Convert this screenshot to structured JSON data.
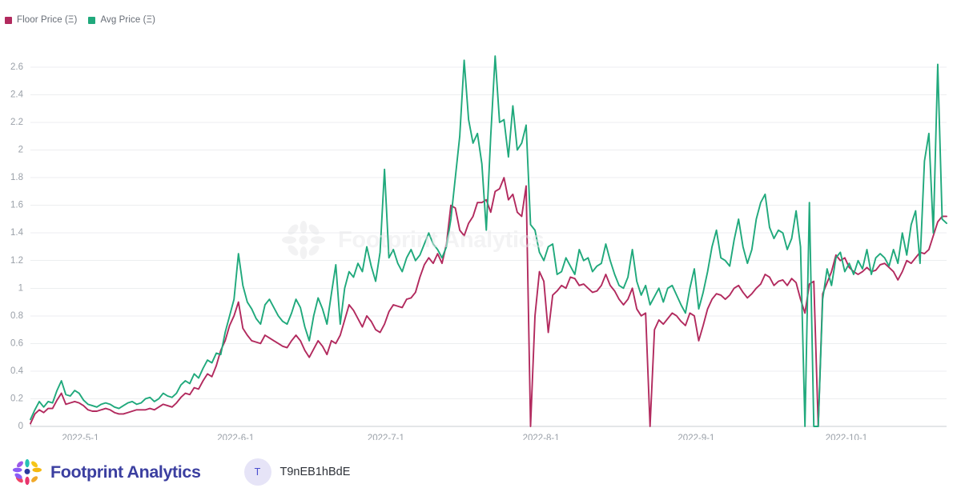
{
  "legend": {
    "items": [
      {
        "label": "Floor Price (Ξ)",
        "color": "#b22a5e",
        "name": "floor-price"
      },
      {
        "label": "Avg Price (Ξ)",
        "color": "#20a97c",
        "name": "avg-price"
      }
    ]
  },
  "watermark": {
    "text": "Footprint Analytics"
  },
  "footer": {
    "brand_name": "Footprint Analytics",
    "avatar_initial": "T",
    "collection_name": "T9nEB1hBdE"
  },
  "chart_data": {
    "type": "line",
    "title": "",
    "xlabel": "",
    "ylabel": "",
    "ylim": [
      0,
      2.75
    ],
    "yticks": [
      0,
      0.2,
      0.4,
      0.6,
      0.8,
      1,
      1.2,
      1.4,
      1.6,
      1.8,
      2,
      2.2,
      2.4,
      2.6
    ],
    "ytick_labels": [
      "0",
      "0.2",
      "0.4",
      "0.6",
      "0.8",
      "1",
      "1.2",
      "1.4",
      "1.6",
      "1.8",
      "2",
      "2.2",
      "2.4",
      "2.6"
    ],
    "xtick_labels": [
      "2022-5-1",
      "2022-6-1",
      "2022-7-1",
      "2022-8-1",
      "2022-9-1",
      "2022-10-1"
    ],
    "xtick_days": [
      10,
      41,
      71,
      102,
      133,
      163
    ],
    "x_domain_days": [
      0,
      183
    ],
    "grid": true,
    "legend_position": "top-left",
    "colors": {
      "floor_price": "#b22a5e",
      "avg_price": "#20a97c",
      "grid": "#eceef0",
      "axis": "#c9ccd1"
    },
    "series": [
      {
        "name": "Floor Price (Ξ)",
        "color": "#b22a5e",
        "values": [
          0.02,
          0.09,
          0.12,
          0.1,
          0.13,
          0.13,
          0.19,
          0.24,
          0.16,
          0.17,
          0.18,
          0.17,
          0.15,
          0.12,
          0.11,
          0.11,
          0.12,
          0.13,
          0.12,
          0.1,
          0.09,
          0.09,
          0.1,
          0.11,
          0.12,
          0.12,
          0.12,
          0.13,
          0.12,
          0.14,
          0.16,
          0.15,
          0.14,
          0.17,
          0.21,
          0.24,
          0.23,
          0.28,
          0.27,
          0.33,
          0.38,
          0.36,
          0.44,
          0.55,
          0.62,
          0.73,
          0.8,
          0.9,
          0.71,
          0.66,
          0.62,
          0.61,
          0.6,
          0.66,
          0.64,
          0.62,
          0.6,
          0.58,
          0.57,
          0.62,
          0.66,
          0.62,
          0.55,
          0.5,
          0.56,
          0.62,
          0.58,
          0.52,
          0.62,
          0.6,
          0.66,
          0.77,
          0.88,
          0.84,
          0.78,
          0.72,
          0.8,
          0.76,
          0.7,
          0.68,
          0.74,
          0.83,
          0.88,
          0.87,
          0.86,
          0.92,
          0.93,
          0.97,
          1.08,
          1.17,
          1.22,
          1.18,
          1.25,
          1.18,
          1.32,
          1.6,
          1.58,
          1.42,
          1.38,
          1.47,
          1.52,
          1.62,
          1.62,
          1.64,
          1.55,
          1.7,
          1.72,
          1.8,
          1.64,
          1.68,
          1.55,
          1.52,
          1.74,
          0.0,
          0.8,
          1.12,
          1.05,
          0.68,
          0.95,
          0.98,
          1.02,
          1.0,
          1.08,
          1.07,
          1.02,
          1.03,
          1.0,
          0.97,
          0.98,
          1.02,
          1.1,
          1.02,
          0.98,
          0.92,
          0.88,
          0.92,
          1.0,
          0.85,
          0.8,
          0.82,
          0.0,
          0.7,
          0.77,
          0.74,
          0.78,
          0.82,
          0.8,
          0.76,
          0.73,
          0.82,
          0.8,
          0.62,
          0.73,
          0.85,
          0.92,
          0.96,
          0.95,
          0.92,
          0.95,
          1.0,
          1.02,
          0.97,
          0.93,
          0.96,
          1.0,
          1.03,
          1.1,
          1.08,
          1.02,
          1.05,
          1.06,
          1.02,
          1.07,
          1.04,
          0.92,
          0.82,
          1.03,
          1.05,
          0.0,
          0.96,
          1.04,
          1.12,
          1.24,
          1.2,
          1.22,
          1.15,
          1.12,
          1.1,
          1.12,
          1.15,
          1.12,
          1.13,
          1.17,
          1.18,
          1.15,
          1.12,
          1.06,
          1.12,
          1.2,
          1.18,
          1.22,
          1.26,
          1.25,
          1.28,
          1.38,
          1.48,
          1.52,
          1.52
        ]
      },
      {
        "name": "Avg Price (Ξ)",
        "color": "#20a97c",
        "values": [
          0.05,
          0.12,
          0.18,
          0.14,
          0.18,
          0.17,
          0.26,
          0.33,
          0.23,
          0.22,
          0.26,
          0.24,
          0.19,
          0.16,
          0.15,
          0.14,
          0.16,
          0.17,
          0.16,
          0.14,
          0.13,
          0.15,
          0.17,
          0.18,
          0.16,
          0.17,
          0.2,
          0.21,
          0.18,
          0.2,
          0.24,
          0.22,
          0.21,
          0.24,
          0.3,
          0.33,
          0.31,
          0.38,
          0.35,
          0.42,
          0.48,
          0.46,
          0.53,
          0.52,
          0.68,
          0.8,
          0.92,
          1.25,
          1.02,
          0.9,
          0.85,
          0.78,
          0.74,
          0.88,
          0.92,
          0.86,
          0.8,
          0.76,
          0.74,
          0.82,
          0.92,
          0.86,
          0.72,
          0.62,
          0.8,
          0.93,
          0.85,
          0.74,
          0.96,
          1.17,
          0.74,
          1.0,
          1.12,
          1.08,
          1.18,
          1.12,
          1.3,
          1.16,
          1.05,
          1.26,
          1.86,
          1.22,
          1.28,
          1.18,
          1.12,
          1.22,
          1.28,
          1.2,
          1.24,
          1.32,
          1.4,
          1.32,
          1.28,
          1.22,
          1.3,
          1.5,
          1.8,
          2.1,
          2.65,
          2.22,
          2.05,
          2.12,
          1.9,
          1.42,
          2.1,
          2.68,
          2.2,
          2.22,
          1.95,
          2.32,
          2.0,
          2.05,
          2.18,
          1.46,
          1.42,
          1.26,
          1.2,
          1.3,
          1.32,
          1.1,
          1.12,
          1.22,
          1.16,
          1.1,
          1.28,
          1.2,
          1.22,
          1.12,
          1.16,
          1.18,
          1.32,
          1.2,
          1.1,
          1.02,
          1.0,
          1.08,
          1.28,
          1.05,
          0.95,
          1.02,
          0.88,
          0.94,
          1.0,
          0.9,
          1.0,
          1.02,
          0.95,
          0.88,
          0.82,
          1.0,
          1.14,
          0.85,
          0.97,
          1.12,
          1.3,
          1.42,
          1.22,
          1.2,
          1.16,
          1.35,
          1.5,
          1.3,
          1.18,
          1.28,
          1.5,
          1.62,
          1.68,
          1.44,
          1.36,
          1.42,
          1.4,
          1.28,
          1.36,
          1.56,
          1.3,
          0.0,
          1.62,
          0.0,
          0.0,
          0.92,
          1.14,
          1.02,
          1.22,
          1.26,
          1.12,
          1.18,
          1.1,
          1.2,
          1.14,
          1.28,
          1.1,
          1.22,
          1.25,
          1.22,
          1.16,
          1.28,
          1.18,
          1.4,
          1.24,
          1.46,
          1.56,
          1.18,
          1.92,
          2.12,
          1.4,
          2.62,
          1.5,
          1.47
        ]
      }
    ]
  }
}
